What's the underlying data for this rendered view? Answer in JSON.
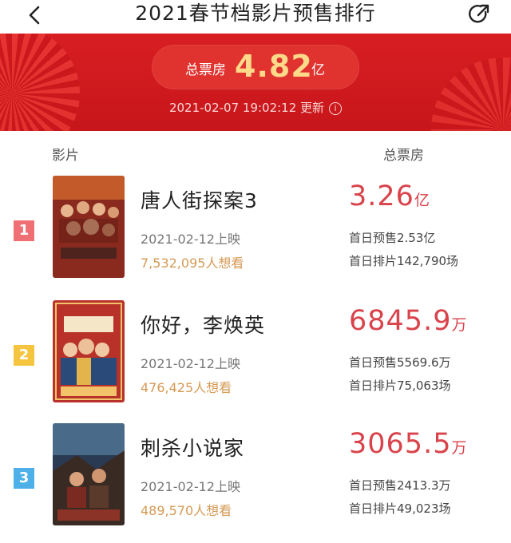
{
  "header": {
    "title": "2021春节档影片预售排行",
    "back_icon": "chevron-left-icon",
    "share_icon": "share-icon"
  },
  "summary": {
    "label": "总票房",
    "value": "4.82",
    "unit": "亿",
    "updated": "2021-02-07 19:02:12 更新",
    "info_icon": "i",
    "accent": "#d81e22",
    "value_color": "#ffd98a"
  },
  "columns": {
    "film": "影片",
    "box_office": "总票房"
  },
  "films": [
    {
      "rank": "1",
      "name": "唐人街探案3",
      "release": "2021-02-12上映",
      "wants": "7,532,095人想看",
      "gross": "3.26",
      "gross_unit": "亿",
      "presale": "首日预售2.53亿",
      "schedule": "首日排片142,790场",
      "poster_text": "唐人街探案",
      "rank_color": "#f06f74"
    },
    {
      "rank": "2",
      "name": "你好，李焕英",
      "release": "2021-02-12上映",
      "wants": "476,425人想看",
      "gross": "6845.9",
      "gross_unit": "万",
      "presale": "首日预售5569.6万",
      "schedule": "首日排片75,063场",
      "poster_text": "你好，李焕英",
      "rank_color": "#f5c540"
    },
    {
      "rank": "3",
      "name": "刺杀小说家",
      "release": "2021-02-12上映",
      "wants": "489,570人想看",
      "gross": "3065.5",
      "gross_unit": "万",
      "presale": "首日预售2413.3万",
      "schedule": "首日排片49,023场",
      "poster_text": "刺杀小说家",
      "rank_color": "#4db0e8"
    }
  ]
}
